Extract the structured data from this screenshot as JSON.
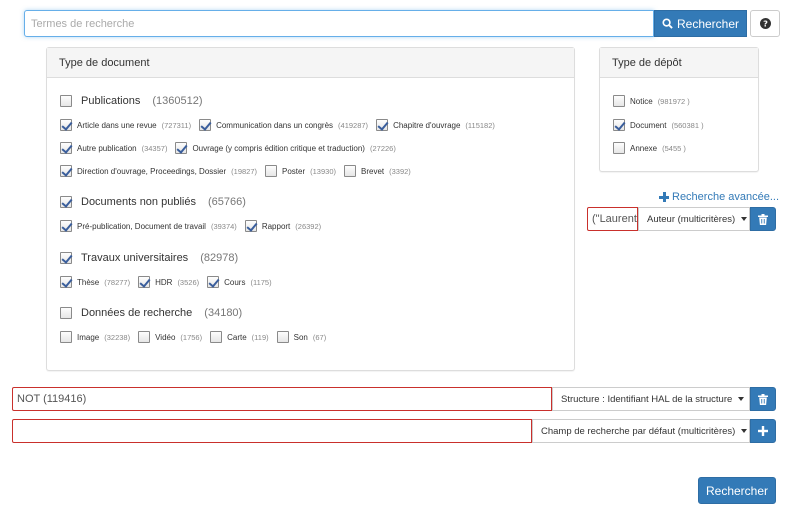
{
  "search": {
    "placeholder": "Termes de recherche",
    "button_label": "Rechercher",
    "help_icon": "question-circle-icon"
  },
  "doc_type_panel": {
    "title": "Type de document",
    "groups": [
      {
        "label": "Publications",
        "count": "(1360512)",
        "checked": false,
        "options": [
          {
            "label": "Article dans une revue",
            "count": "(727311)",
            "checked": true
          },
          {
            "label": "Communication dans un congrès",
            "count": "(419287)",
            "checked": true
          },
          {
            "label": "Chapitre d'ouvrage",
            "count": "(115182)",
            "checked": true
          },
          {
            "label": "Autre publication",
            "count": "(34357)",
            "checked": true
          },
          {
            "label": "Ouvrage (y compris édition critique et traduction)",
            "count": "(27226)",
            "checked": true
          },
          {
            "label": "Direction d'ouvrage, Proceedings, Dossier",
            "count": "(19827)",
            "checked": true
          },
          {
            "label": "Poster",
            "count": "(13930)",
            "checked": false
          },
          {
            "label": "Brevet",
            "count": "(3392)",
            "checked": false
          }
        ]
      },
      {
        "label": "Documents non publiés",
        "count": "(65766)",
        "checked": true,
        "options": [
          {
            "label": "Pré-publication, Document de travail",
            "count": "(39374)",
            "checked": true
          },
          {
            "label": "Rapport",
            "count": "(26392)",
            "checked": true
          }
        ]
      },
      {
        "label": "Travaux universitaires",
        "count": "(82978)",
        "checked": true,
        "options": [
          {
            "label": "Thèse",
            "count": "(78277)",
            "checked": true
          },
          {
            "label": "HDR",
            "count": "(3526)",
            "checked": true
          },
          {
            "label": "Cours",
            "count": "(1175)",
            "checked": true
          }
        ]
      },
      {
        "label": "Données de recherche",
        "count": "(34180)",
        "checked": false,
        "options": [
          {
            "label": "Image",
            "count": "(32238)",
            "checked": false
          },
          {
            "label": "Vidéo",
            "count": "(1756)",
            "checked": false
          },
          {
            "label": "Carte",
            "count": "(119)",
            "checked": false
          },
          {
            "label": "Son",
            "count": "(67)",
            "checked": false
          }
        ]
      }
    ]
  },
  "depot_panel": {
    "title": "Type de dépôt",
    "options": [
      {
        "label": "Notice",
        "count": "(981972 )",
        "checked": false
      },
      {
        "label": "Document",
        "count": "(560381 )",
        "checked": true
      },
      {
        "label": "Annexe",
        "count": "(5455 )",
        "checked": false
      }
    ]
  },
  "advanced": {
    "link_label": "Recherche avancée...",
    "author": {
      "value": "(\"Laurent",
      "field": "Auteur (multicritères)"
    },
    "structure": {
      "value": "NOT (119416)",
      "field": "Structure : Identifiant HAL de la structure"
    },
    "default_field": {
      "value": "",
      "field": "Champ de recherche par défaut (multicritères)"
    }
  },
  "submit": {
    "label": "Rechercher"
  },
  "colors": {
    "primary": "#337ab7",
    "error_border": "#c9302c"
  }
}
